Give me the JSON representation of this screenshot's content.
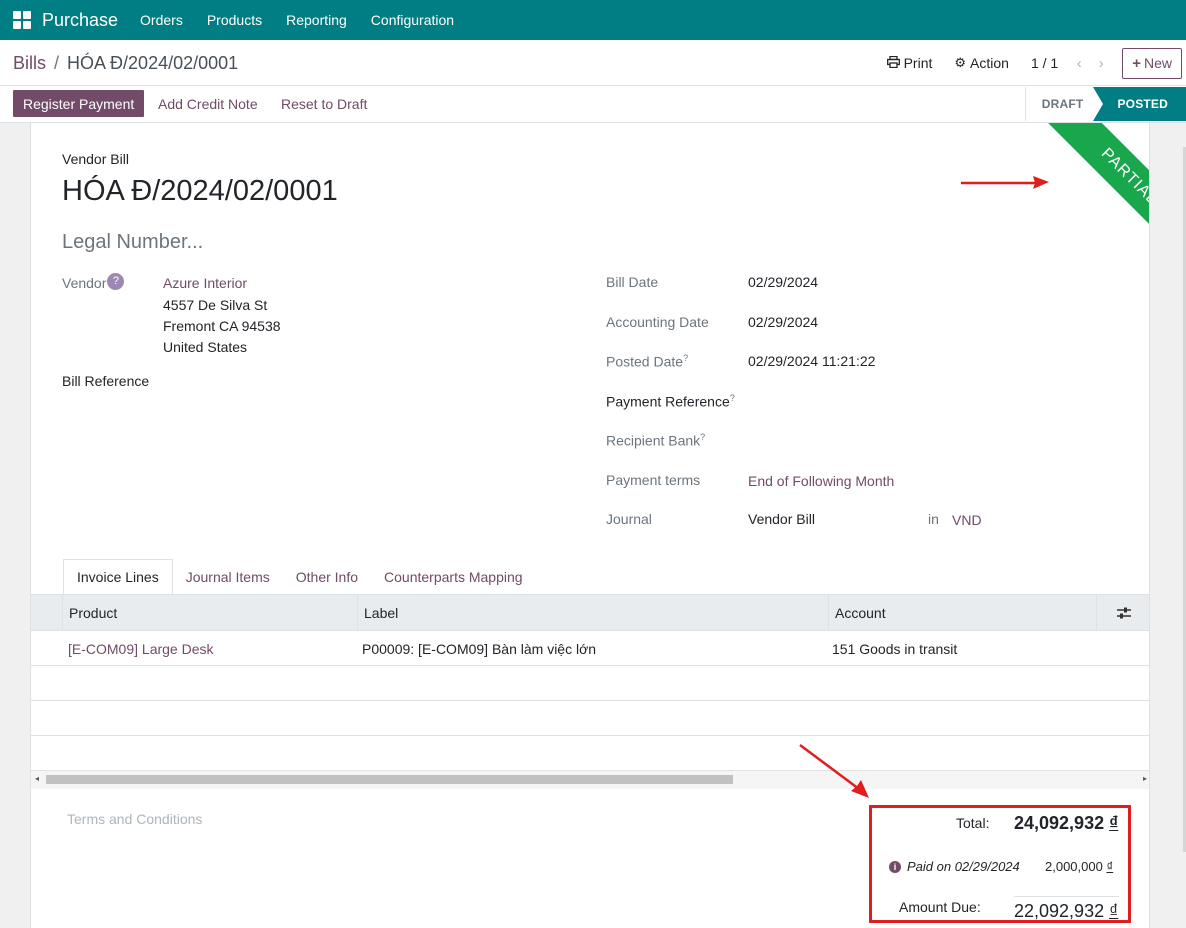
{
  "topnav": {
    "brand": "Purchase",
    "menu": [
      "Orders",
      "Products",
      "Reporting",
      "Configuration"
    ]
  },
  "breadcrumb": {
    "parent": "Bills",
    "separator": "/",
    "current": "HÓA Đ/2024/02/0001"
  },
  "control": {
    "print": "Print",
    "action": "Action",
    "pager": "1 / 1",
    "new": "New"
  },
  "buttons": {
    "register_payment": "Register Payment",
    "add_credit_note": "Add Credit Note",
    "reset_to_draft": "Reset to Draft"
  },
  "stages": {
    "draft": "DRAFT",
    "posted": "POSTED"
  },
  "ribbon": "PARTIAL",
  "form": {
    "type_label": "Vendor Bill",
    "name": "HÓA Đ/2024/02/0001",
    "legal_number_placeholder": "Legal Number...",
    "vendor_label": "Vendor",
    "vendor_help": "?",
    "vendor_name": "Azure Interior",
    "vendor_address": [
      "4557 De Silva St",
      "Fremont CA 94538",
      "United States"
    ],
    "bill_reference_label": "Bill Reference",
    "bill_date_label": "Bill Date",
    "bill_date": "02/29/2024",
    "accounting_date_label": "Accounting Date",
    "accounting_date": "02/29/2024",
    "posted_date_label": "Posted Date",
    "posted_date": "02/29/2024 11:21:22",
    "payment_reference_label": "Payment Reference",
    "recipient_bank_label": "Recipient Bank",
    "payment_terms_label": "Payment terms",
    "payment_terms": "End of Following Month",
    "journal_label": "Journal",
    "journal": "Vendor Bill",
    "journal_in": "in",
    "currency": "VND",
    "help_mark": "?"
  },
  "tabs": [
    "Invoice Lines",
    "Journal Items",
    "Other Info",
    "Counterparts Mapping"
  ],
  "table": {
    "headers": [
      "Product",
      "Label",
      "Account"
    ],
    "rows": [
      {
        "product": "[E-COM09] Large Desk",
        "label": "P00009: [E-COM09] Bàn làm việc lớn",
        "account": "151 Goods in transit"
      }
    ]
  },
  "terms_placeholder": "Terms and Conditions",
  "totals": {
    "total_label": "Total:",
    "total_value": "24,092,932",
    "paid_text": "Paid on 02/29/2024",
    "paid_value": "2,000,000",
    "amount_due_label": "Amount Due:",
    "amount_due_value": "22,092,932",
    "currency_symbol": "₫"
  },
  "colors": {
    "nav": "#017e84",
    "primary": "#714b67",
    "ribbon": "#1aa64c",
    "highlight": "#e11d1d"
  }
}
